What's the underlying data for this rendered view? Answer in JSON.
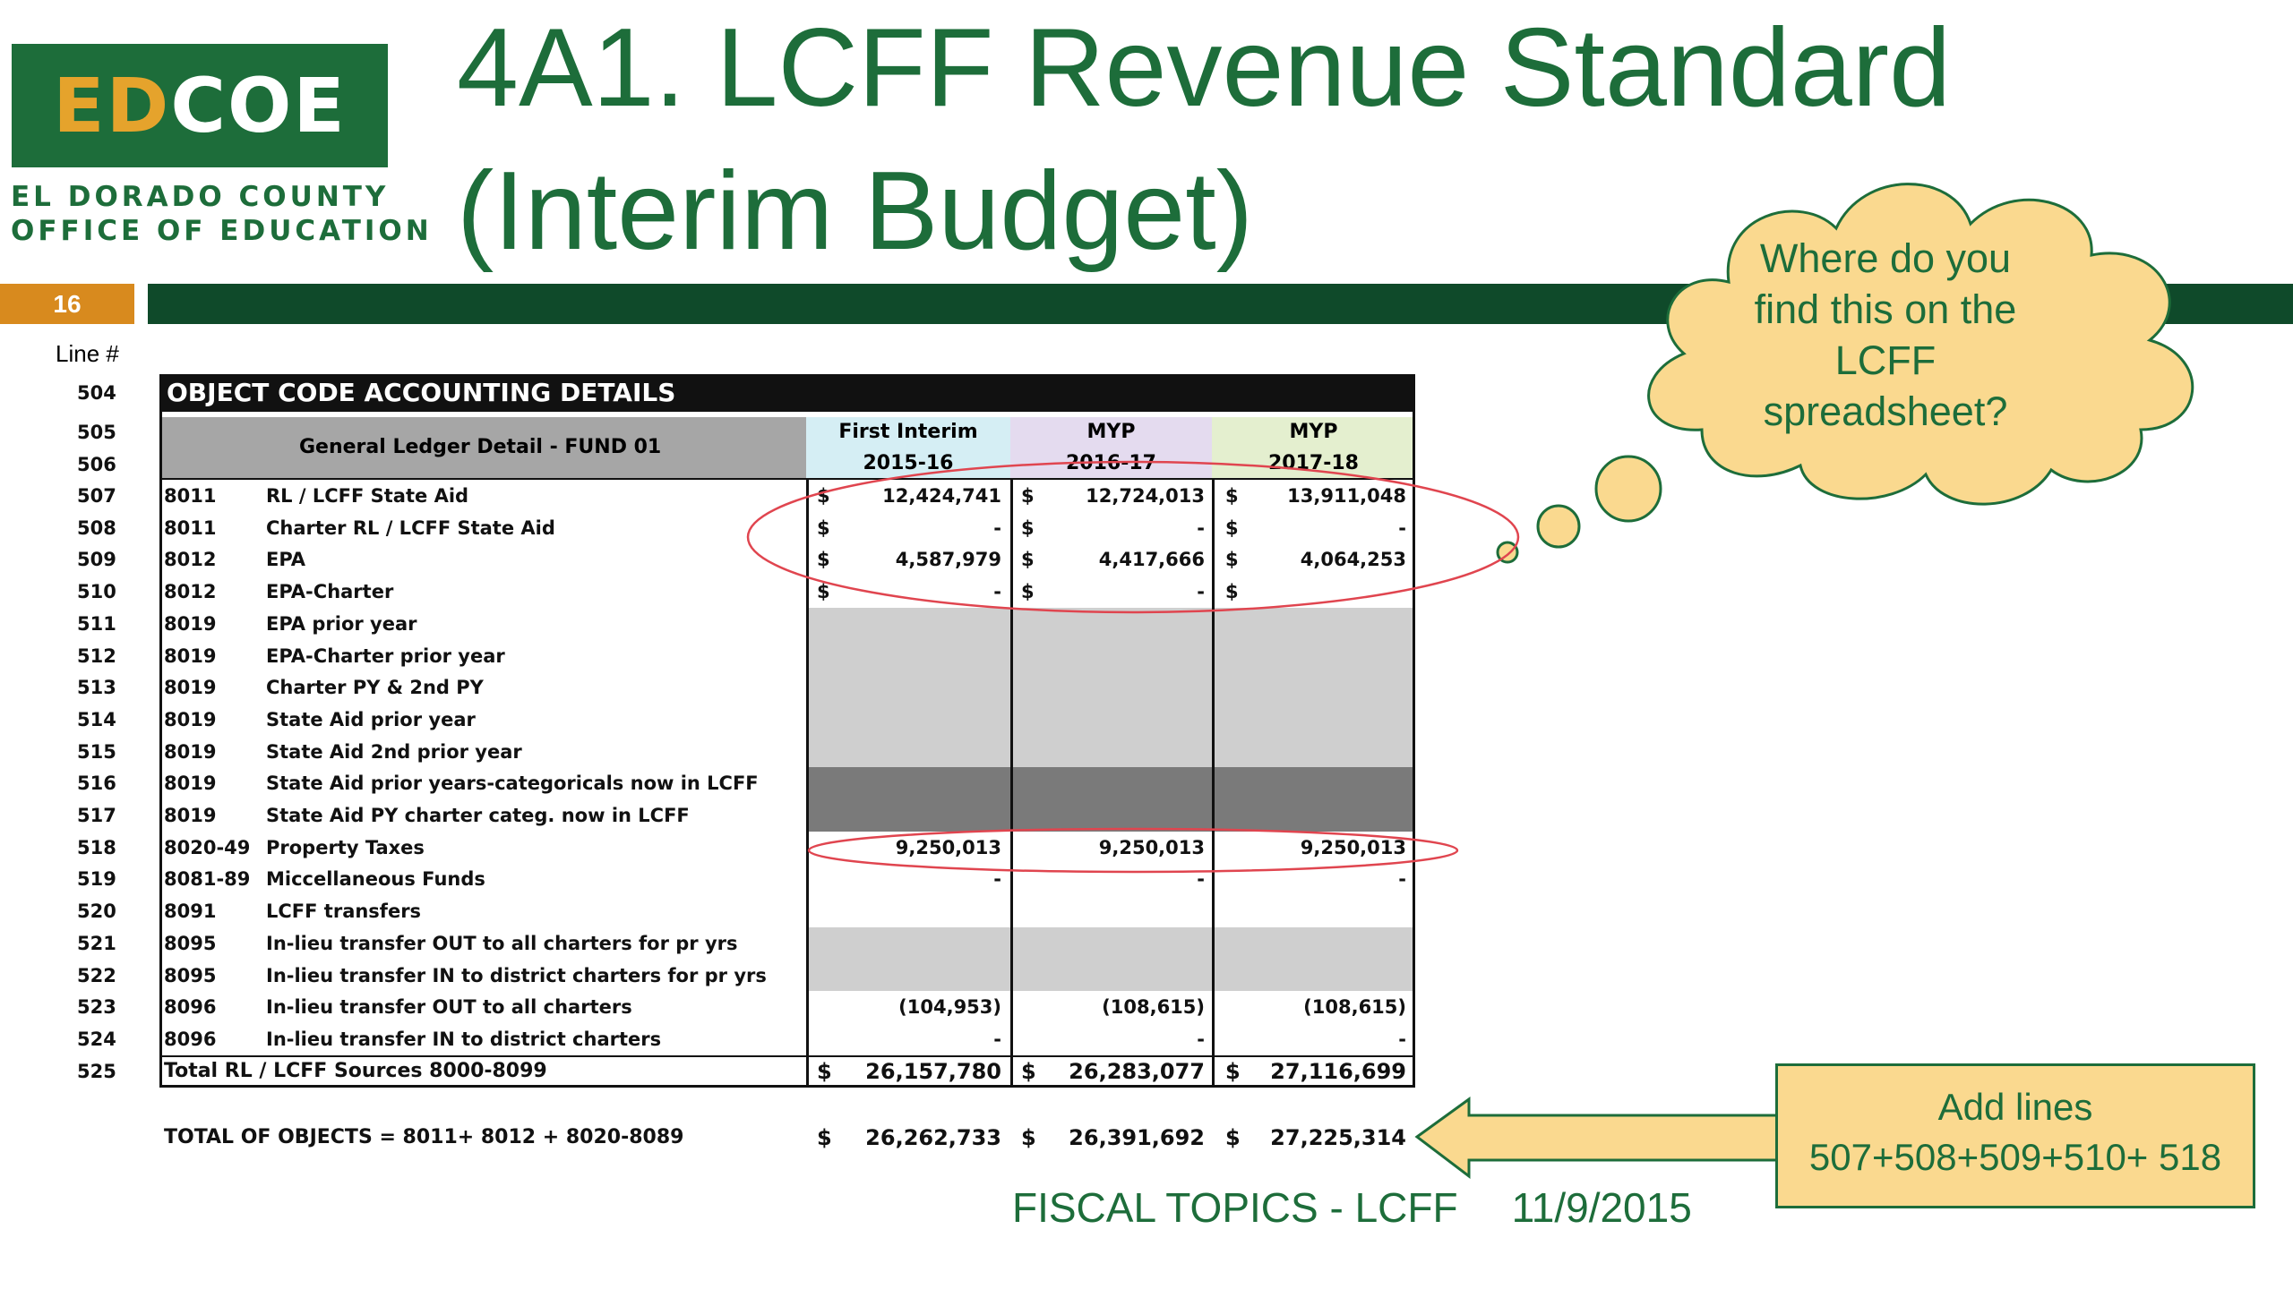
{
  "logo": {
    "part1": "ED",
    "part2": "COE",
    "org_line_1": "EL DORADO COUNTY",
    "org_line_2": "OFFICE OF EDUCATION"
  },
  "title": {
    "line1": "4A1. LCFF Revenue Standard",
    "line2": "(Interim Budget)"
  },
  "slide_number": "16",
  "line_header": "Line #",
  "table": {
    "section_title": "OBJECT CODE ACCOUNTING DETAILS",
    "ledger_header": "General Ledger Detail - FUND 01",
    "columns": [
      {
        "top": "First Interim",
        "bottom": "2015-16"
      },
      {
        "top": "MYP",
        "bottom": "2016-17"
      },
      {
        "top": "MYP",
        "bottom": "2017-18"
      }
    ],
    "header_line_numbers": [
      "504",
      "505",
      "506"
    ],
    "rows": [
      {
        "line": "507",
        "code": "8011",
        "desc": "RL / LCFF State Aid",
        "d1": "$",
        "v1": "12,424,741",
        "d2": "$",
        "v2": "12,724,013",
        "d3": "$",
        "v3": "13,911,048"
      },
      {
        "line": "508",
        "code": "8011",
        "desc": "Charter RL / LCFF State Aid",
        "d1": "$",
        "v1": "-",
        "d2": "$",
        "v2": "-",
        "d3": "$",
        "v3": "-"
      },
      {
        "line": "509",
        "code": "8012",
        "desc": "EPA",
        "d1": "$",
        "v1": "4,587,979",
        "d2": "$",
        "v2": "4,417,666",
        "d3": "$",
        "v3": "4,064,253"
      },
      {
        "line": "510",
        "code": "8012",
        "desc": "EPA-Charter",
        "d1": "$",
        "v1": "-",
        "d2": "$",
        "v2": "-",
        "d3": "$",
        "v3": ""
      },
      {
        "line": "511",
        "code": "8019",
        "desc": "EPA prior year",
        "d1": "",
        "v1": "",
        "d2": "",
        "v2": "",
        "d3": "",
        "v3": ""
      },
      {
        "line": "512",
        "code": "8019",
        "desc": "EPA-Charter prior year",
        "d1": "",
        "v1": "",
        "d2": "",
        "v2": "",
        "d3": "",
        "v3": ""
      },
      {
        "line": "513",
        "code": "8019",
        "desc": "Charter PY & 2nd PY",
        "d1": "",
        "v1": "",
        "d2": "",
        "v2": "",
        "d3": "",
        "v3": ""
      },
      {
        "line": "514",
        "code": "8019",
        "desc": "State Aid prior year",
        "d1": "",
        "v1": "",
        "d2": "",
        "v2": "",
        "d3": "",
        "v3": ""
      },
      {
        "line": "515",
        "code": "8019",
        "desc": "State Aid 2nd prior year",
        "d1": "",
        "v1": "",
        "d2": "",
        "v2": "",
        "d3": "",
        "v3": ""
      },
      {
        "line": "516",
        "code": "8019",
        "desc": "State Aid prior years-categoricals now in LCFF",
        "d1": "",
        "v1": "",
        "d2": "",
        "v2": "",
        "d3": "",
        "v3": ""
      },
      {
        "line": "517",
        "code": "8019",
        "desc": "State Aid PY charter categ. now in LCFF",
        "d1": "",
        "v1": "",
        "d2": "",
        "v2": "",
        "d3": "",
        "v3": ""
      },
      {
        "line": "518",
        "code": "8020-49",
        "desc": "Property Taxes",
        "d1": "",
        "v1": "9,250,013",
        "d2": "",
        "v2": "9,250,013",
        "d3": "",
        "v3": "9,250,013"
      },
      {
        "line": "519",
        "code": "8081-89",
        "desc": "Miccellaneous Funds",
        "d1": "",
        "v1": "-",
        "d2": "",
        "v2": "-",
        "d3": "",
        "v3": "-"
      },
      {
        "line": "520",
        "code": "8091",
        "desc": "LCFF transfers",
        "d1": "",
        "v1": "",
        "d2": "",
        "v2": "",
        "d3": "",
        "v3": ""
      },
      {
        "line": "521",
        "code": "8095",
        "desc": "In-lieu transfer OUT to all charters for pr yrs",
        "d1": "",
        "v1": "",
        "d2": "",
        "v2": "",
        "d3": "",
        "v3": ""
      },
      {
        "line": "522",
        "code": "8095",
        "desc": "In-lieu transfer IN to district charters for pr yrs",
        "d1": "",
        "v1": "",
        "d2": "",
        "v2": "",
        "d3": "",
        "v3": ""
      },
      {
        "line": "523",
        "code": "8096",
        "desc": "In-lieu transfer OUT to all charters",
        "d1": "",
        "v1": "(104,953)",
        "d2": "",
        "v2": "(108,615)",
        "d3": "",
        "v3": "(108,615)"
      },
      {
        "line": "524",
        "code": "8096",
        "desc": "In-lieu transfer IN to district charters",
        "d1": "",
        "v1": "-",
        "d2": "",
        "v2": "-",
        "d3": "",
        "v3": "-"
      },
      {
        "line": "525",
        "code": "",
        "desc": "Total RL / LCFF Sources 8000-8099",
        "d1": "$",
        "v1": "26,157,780",
        "d2": "$",
        "v2": "26,283,077",
        "d3": "$",
        "v3": "27,116,699"
      }
    ],
    "total_objects": {
      "desc": "TOTAL OF OBJECTS = 8011+ 8012 +  8020-8089",
      "d1": "$",
      "v1": "26,262,733",
      "d2": "$",
      "v2": "26,391,692",
      "d3": "$",
      "v3": "27,225,314"
    }
  },
  "callout_cloud": {
    "lines": [
      "Where do you",
      "find this on the",
      "LCFF",
      "spreadsheet?"
    ]
  },
  "callout_box": {
    "lines": [
      "Add lines",
      "507+508+509+510+ 518"
    ]
  },
  "footer": {
    "text": "FISCAL TOPICS - LCFF",
    "date": "11/9/2015"
  },
  "colors": {
    "green": "#1d6d3a",
    "dark_green": "#0f4a2a",
    "orange": "#d88a1e",
    "callout_fill": "#fad98f",
    "highlight_red": "#e0454f"
  }
}
